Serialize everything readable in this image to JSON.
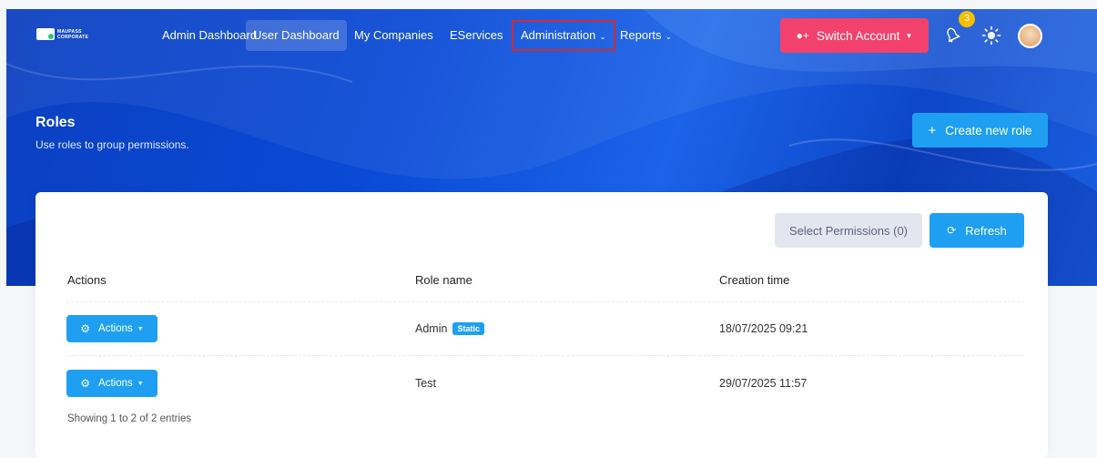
{
  "brand": {
    "name": "MAUPASS",
    "sub": "CORPORATE"
  },
  "nav": {
    "items": [
      {
        "label": "Admin Dashboard"
      },
      {
        "label": "User Dashboard"
      },
      {
        "label": "My Companies"
      },
      {
        "label": "EServices"
      },
      {
        "label": "Administration"
      },
      {
        "label": "Reports"
      }
    ],
    "switch_account": "Switch Account",
    "notification_count": "3"
  },
  "page": {
    "title": "Roles",
    "subtitle": "Use roles to group permissions.",
    "create_button": "Create new role"
  },
  "toolbar": {
    "select_permissions": "Select Permissions (0)",
    "refresh": "Refresh"
  },
  "table": {
    "headers": [
      "Actions",
      "Role name",
      "Creation time"
    ],
    "rows": [
      {
        "action_label": "Actions",
        "role_name": "Admin",
        "badge": "Static",
        "created": "18/07/2025 09:21"
      },
      {
        "action_label": "Actions",
        "role_name": "Test",
        "badge": "",
        "created": "29/07/2025 11:57"
      }
    ],
    "info": "Showing 1 to 2 of 2 entries"
  },
  "colors": {
    "primary": "#1e9ff2",
    "danger": "#f1416c",
    "hero": "#0a4ad6",
    "badge_yellow": "#f6c000"
  }
}
